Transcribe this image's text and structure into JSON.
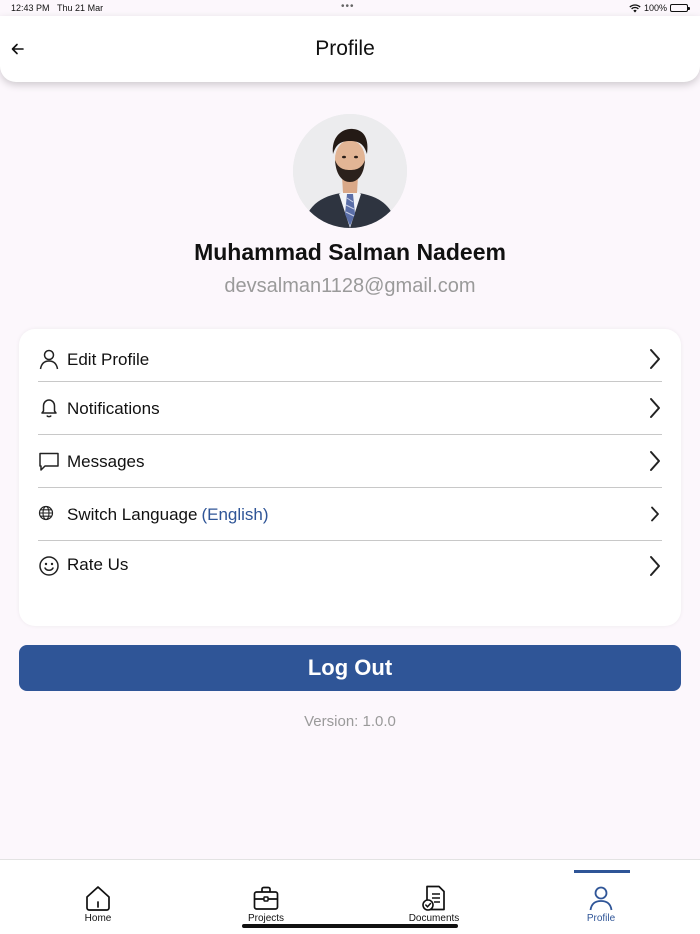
{
  "status_bar": {
    "time": "12:43 PM",
    "date": "Thu 21 Mar",
    "battery": "100%"
  },
  "header": {
    "title": "Profile",
    "back_icon": "arrow-left-icon"
  },
  "profile": {
    "name": "Muhammad Salman Nadeem",
    "email": "devsalman1128@gmail.com"
  },
  "menu": {
    "items": [
      {
        "label": "Edit Profile",
        "icon": "user-icon"
      },
      {
        "label": "Notifications",
        "icon": "bell-icon"
      },
      {
        "label": "Messages",
        "icon": "message-icon"
      },
      {
        "label": "Switch Language",
        "suffix": "(English)",
        "icon": "globe-icon"
      },
      {
        "label": "Rate Us",
        "icon": "smile-icon"
      }
    ]
  },
  "logout_label": "Log Out",
  "version": "Version: 1.0.0",
  "tabs": [
    {
      "label": "Home",
      "icon": "home-icon"
    },
    {
      "label": "Projects",
      "icon": "briefcase-icon"
    },
    {
      "label": "Documents",
      "icon": "document-icon"
    },
    {
      "label": "Profile",
      "icon": "person-icon",
      "active": true
    }
  ],
  "colors": {
    "accent": "#2f5597",
    "background": "#fcf7fc"
  }
}
